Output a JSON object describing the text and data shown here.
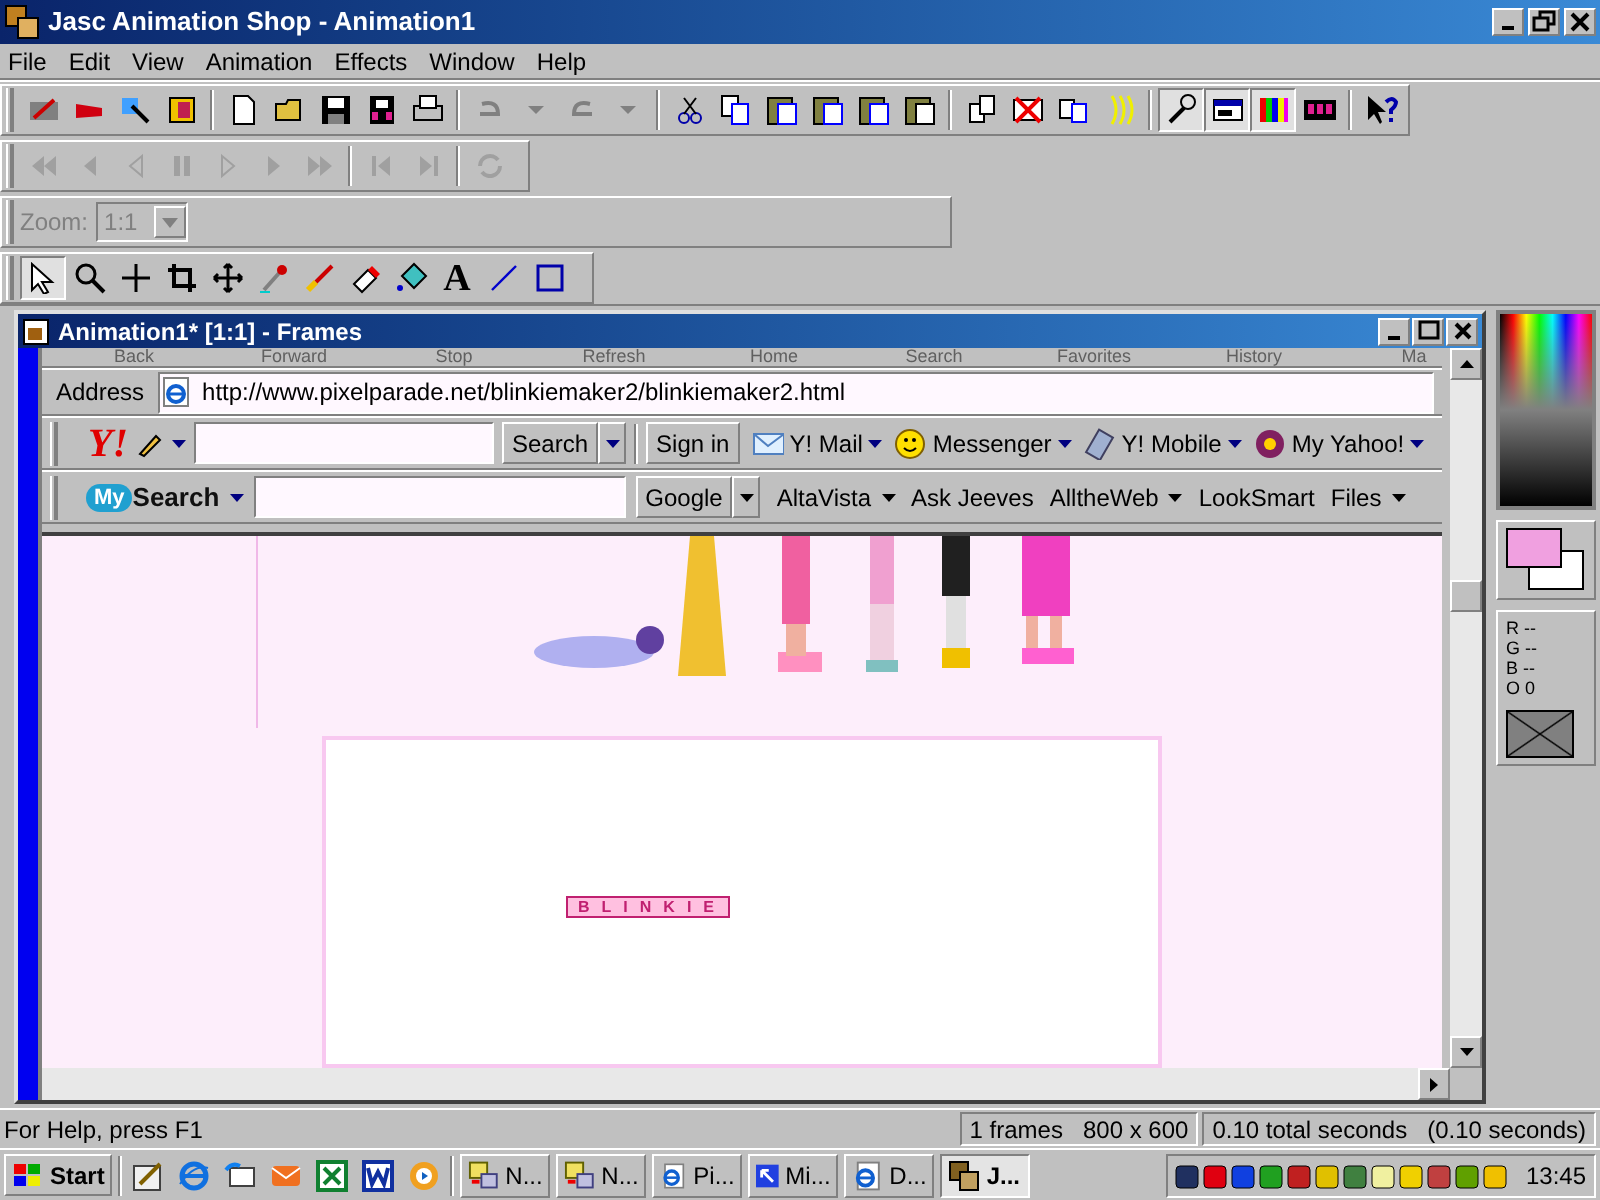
{
  "window": {
    "title": "Jasc Animation Shop - Animation1"
  },
  "menu": [
    "File",
    "Edit",
    "View",
    "Animation",
    "Effects",
    "Window",
    "Help"
  ],
  "view_toggles": [
    {
      "kind": "wrench",
      "selected": true
    },
    {
      "kind": "vcr",
      "selected": true
    },
    {
      "kind": "palette",
      "selected": true
    },
    {
      "kind": "film",
      "selected": false
    }
  ],
  "zoom": {
    "label": "Zoom:",
    "value": "1:1",
    "disabled": true
  },
  "tools": [
    {
      "kind": "arrow",
      "selected": true
    },
    {
      "kind": "magnifier",
      "selected": false
    },
    {
      "kind": "crosshair",
      "selected": false
    },
    {
      "kind": "crop",
      "selected": false
    },
    {
      "kind": "move",
      "selected": false
    },
    {
      "kind": "dropper",
      "selected": false
    },
    {
      "kind": "brush",
      "selected": false
    },
    {
      "kind": "eraser",
      "selected": false
    },
    {
      "kind": "fill",
      "selected": false
    },
    {
      "kind": "text",
      "glyph": "A",
      "selected": false
    },
    {
      "kind": "line",
      "selected": false
    },
    {
      "kind": "rectangle",
      "selected": false
    }
  ],
  "document": {
    "title": "Animation1* [1:1] - Frames",
    "browser": {
      "toolbar_labels": [
        "Back",
        "Forward",
        "Stop",
        "Refresh",
        "Home",
        "Search",
        "Favorites",
        "History",
        "Ma"
      ],
      "address_label": "Address",
      "url": "http://www.pixelparade.net/blinkiemaker2/blinkiemaker2.html",
      "yahoo_bar": {
        "logo": "Y!",
        "search_button": "Search",
        "sign_in": "Sign in",
        "items": [
          {
            "label": "Y! Mail",
            "kind": "mail"
          },
          {
            "label": "Messenger",
            "kind": "smiley"
          },
          {
            "label": "Y! Mobile",
            "kind": "phone"
          },
          {
            "label": "My Yahoo!",
            "kind": "myyahoo"
          }
        ]
      },
      "search_bar": {
        "logo_badge": "My",
        "logo_text": "Search",
        "engine": "Google",
        "links": [
          {
            "label": "AltaVista",
            "menu": true
          },
          {
            "label": "Ask Jeeves",
            "menu": false
          },
          {
            "label": "AlltheWeb",
            "menu": true
          },
          {
            "label": "LookSmart",
            "menu": false
          },
          {
            "label": "Files",
            "menu": true
          }
        ]
      },
      "page": {
        "blinkie": "BLINKIE"
      }
    }
  },
  "color_info": [
    "R --",
    "G --",
    "B --",
    "O 0"
  ],
  "status_bar": {
    "help": "For Help, press F1",
    "frames": "1 frames",
    "size": "800 x 600",
    "total": "0.10 total seconds",
    "per_frame": "(0.10 seconds)"
  },
  "taskbar": {
    "start": "Start",
    "buttons": [
      {
        "label": "N...",
        "kind": "network",
        "selected": false
      },
      {
        "label": "N...",
        "kind": "network",
        "selected": false
      },
      {
        "label": "Pi...",
        "kind": "web",
        "selected": false
      },
      {
        "label": "Mi...",
        "kind": "arrow",
        "selected": false
      },
      {
        "label": "D...",
        "kind": "web",
        "selected": false
      },
      {
        "label": "J...",
        "kind": "jasc",
        "selected": true
      }
    ],
    "clock": "13:45"
  }
}
